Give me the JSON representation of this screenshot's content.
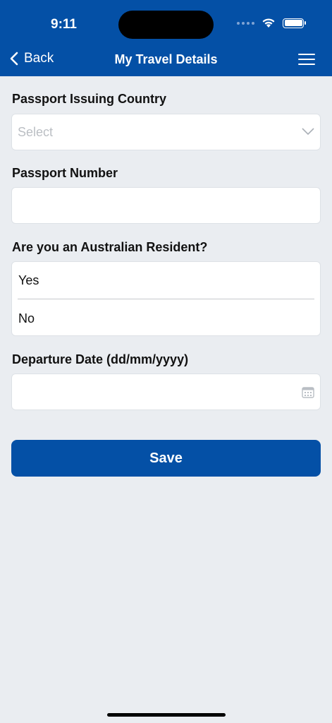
{
  "status": {
    "time": "9:11"
  },
  "header": {
    "back_label": "Back",
    "title": "My Travel Details"
  },
  "form": {
    "passport_country": {
      "label": "Passport Issuing Country",
      "placeholder": "Select"
    },
    "passport_number": {
      "label": "Passport Number",
      "value": ""
    },
    "resident": {
      "label": "Are you an Australian Resident?",
      "options": [
        "Yes",
        "No"
      ]
    },
    "departure_date": {
      "label": "Departure Date (dd/mm/yyyy)",
      "value": ""
    },
    "save_label": "Save"
  },
  "colors": {
    "brand": "#0450a6",
    "background": "#eaedf1"
  },
  "icons": [
    "chevron-left-icon",
    "hamburger-menu-icon",
    "chevron-down-icon",
    "calendar-icon",
    "wifi-icon",
    "battery-icon"
  ]
}
